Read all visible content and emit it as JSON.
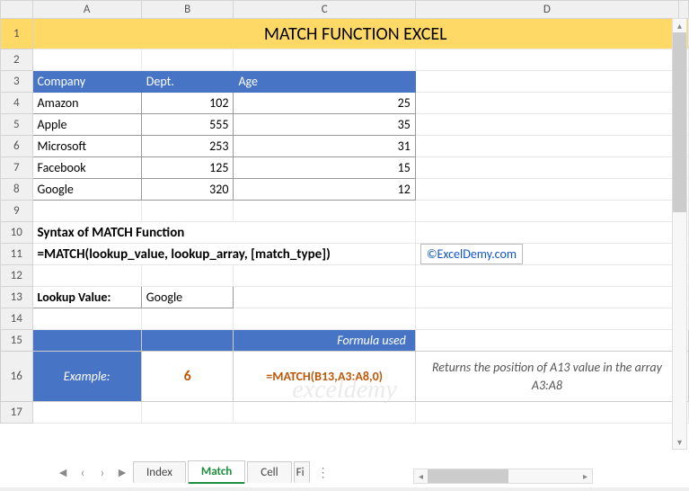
{
  "columns": [
    "A",
    "B",
    "C",
    "D"
  ],
  "title": "MATCH FUNCTION EXCEL",
  "table": {
    "headers": {
      "company": "Company",
      "dept": "Dept.",
      "age": "Age"
    },
    "rows": [
      {
        "company": "Amazon",
        "dept": "102",
        "age": "25"
      },
      {
        "company": "Apple",
        "dept": "555",
        "age": "35"
      },
      {
        "company": "Microsoft",
        "dept": "253",
        "age": "31"
      },
      {
        "company": "Facebook",
        "dept": "125",
        "age": "15"
      },
      {
        "company": "Google",
        "dept": "320",
        "age": "12"
      }
    ]
  },
  "syntax_heading": "Syntax of MATCH Function",
  "syntax_formula": "=MATCH(lookup_value, lookup_array, [match_type])",
  "copyright": "©ExcelDemy.com",
  "lookup": {
    "label": "Lookup Value:",
    "value": "Google"
  },
  "example": {
    "fu_label": "Formula used",
    "label": "Example:",
    "result": "6",
    "formula": "=MATCH(B13,A3:A8,0)",
    "description": "Returns the position of A13 value in the array A3:A8"
  },
  "tabs": {
    "prev": "Index",
    "active": "Match",
    "next": "Cell",
    "partial": "Fi"
  },
  "watermark": "exceldemy"
}
